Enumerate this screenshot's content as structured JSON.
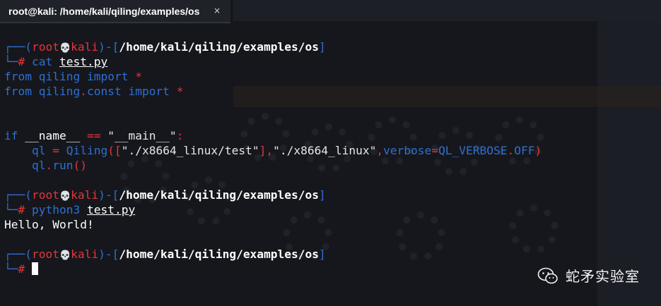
{
  "tab": {
    "title": "root@kali: /home/kali/qiling/examples/os",
    "close_glyph": "×"
  },
  "prompt": {
    "corner_top": "┌──(",
    "user": "root",
    "skull": "💀",
    "host": "kali",
    "close_paren": ")-[",
    "path": "/home/kali/qiling/examples/os",
    "close_bracket": "]",
    "corner_bottom": "└─",
    "hash": "#"
  },
  "commands": {
    "cat_cmd": "cat",
    "cat_arg": "test.py",
    "run_cmd": "python3",
    "run_arg": "test.py"
  },
  "code": {
    "l1_from": "from",
    "l1_mod": "qiling",
    "l1_import": "import",
    "l1_star": "*",
    "l2_from": "from",
    "l2_mod": "qiling",
    "l2_dot": ".",
    "l2_sub": "const",
    "l2_import": "import",
    "l2_star": "*",
    "l3_if": "if",
    "l3_name": "__name__",
    "l3_eq": "==",
    "l3_str": "\"__main__\"",
    "l3_colon": ":",
    "l4_ql": "ql",
    "l4_eq": "=",
    "l4_cls": "Qiling",
    "l4_open": "([",
    "l4_arg1": "\"./x8664_linux/test\"",
    "l4_close": "],",
    "l4_arg2": "\"./x8664_linux\"",
    "l4_comma": ",",
    "l4_kw": "verbose",
    "l4_kweq": "=",
    "l4_const": "QL_VERBOSE",
    "l4_dot": ".",
    "l4_attr": "OFF",
    "l4_end": ")",
    "l5_ql": "ql",
    "l5_dot": ".",
    "l5_run": "run",
    "l5_call": "()"
  },
  "output": {
    "hello": "Hello, World!"
  },
  "watermark": {
    "text": "蛇矛实验室",
    "icon": "wechat-icon"
  },
  "colors": {
    "prompt_blue": "#2f6fd2",
    "prompt_red": "#e4353a",
    "background": "#15171c"
  }
}
